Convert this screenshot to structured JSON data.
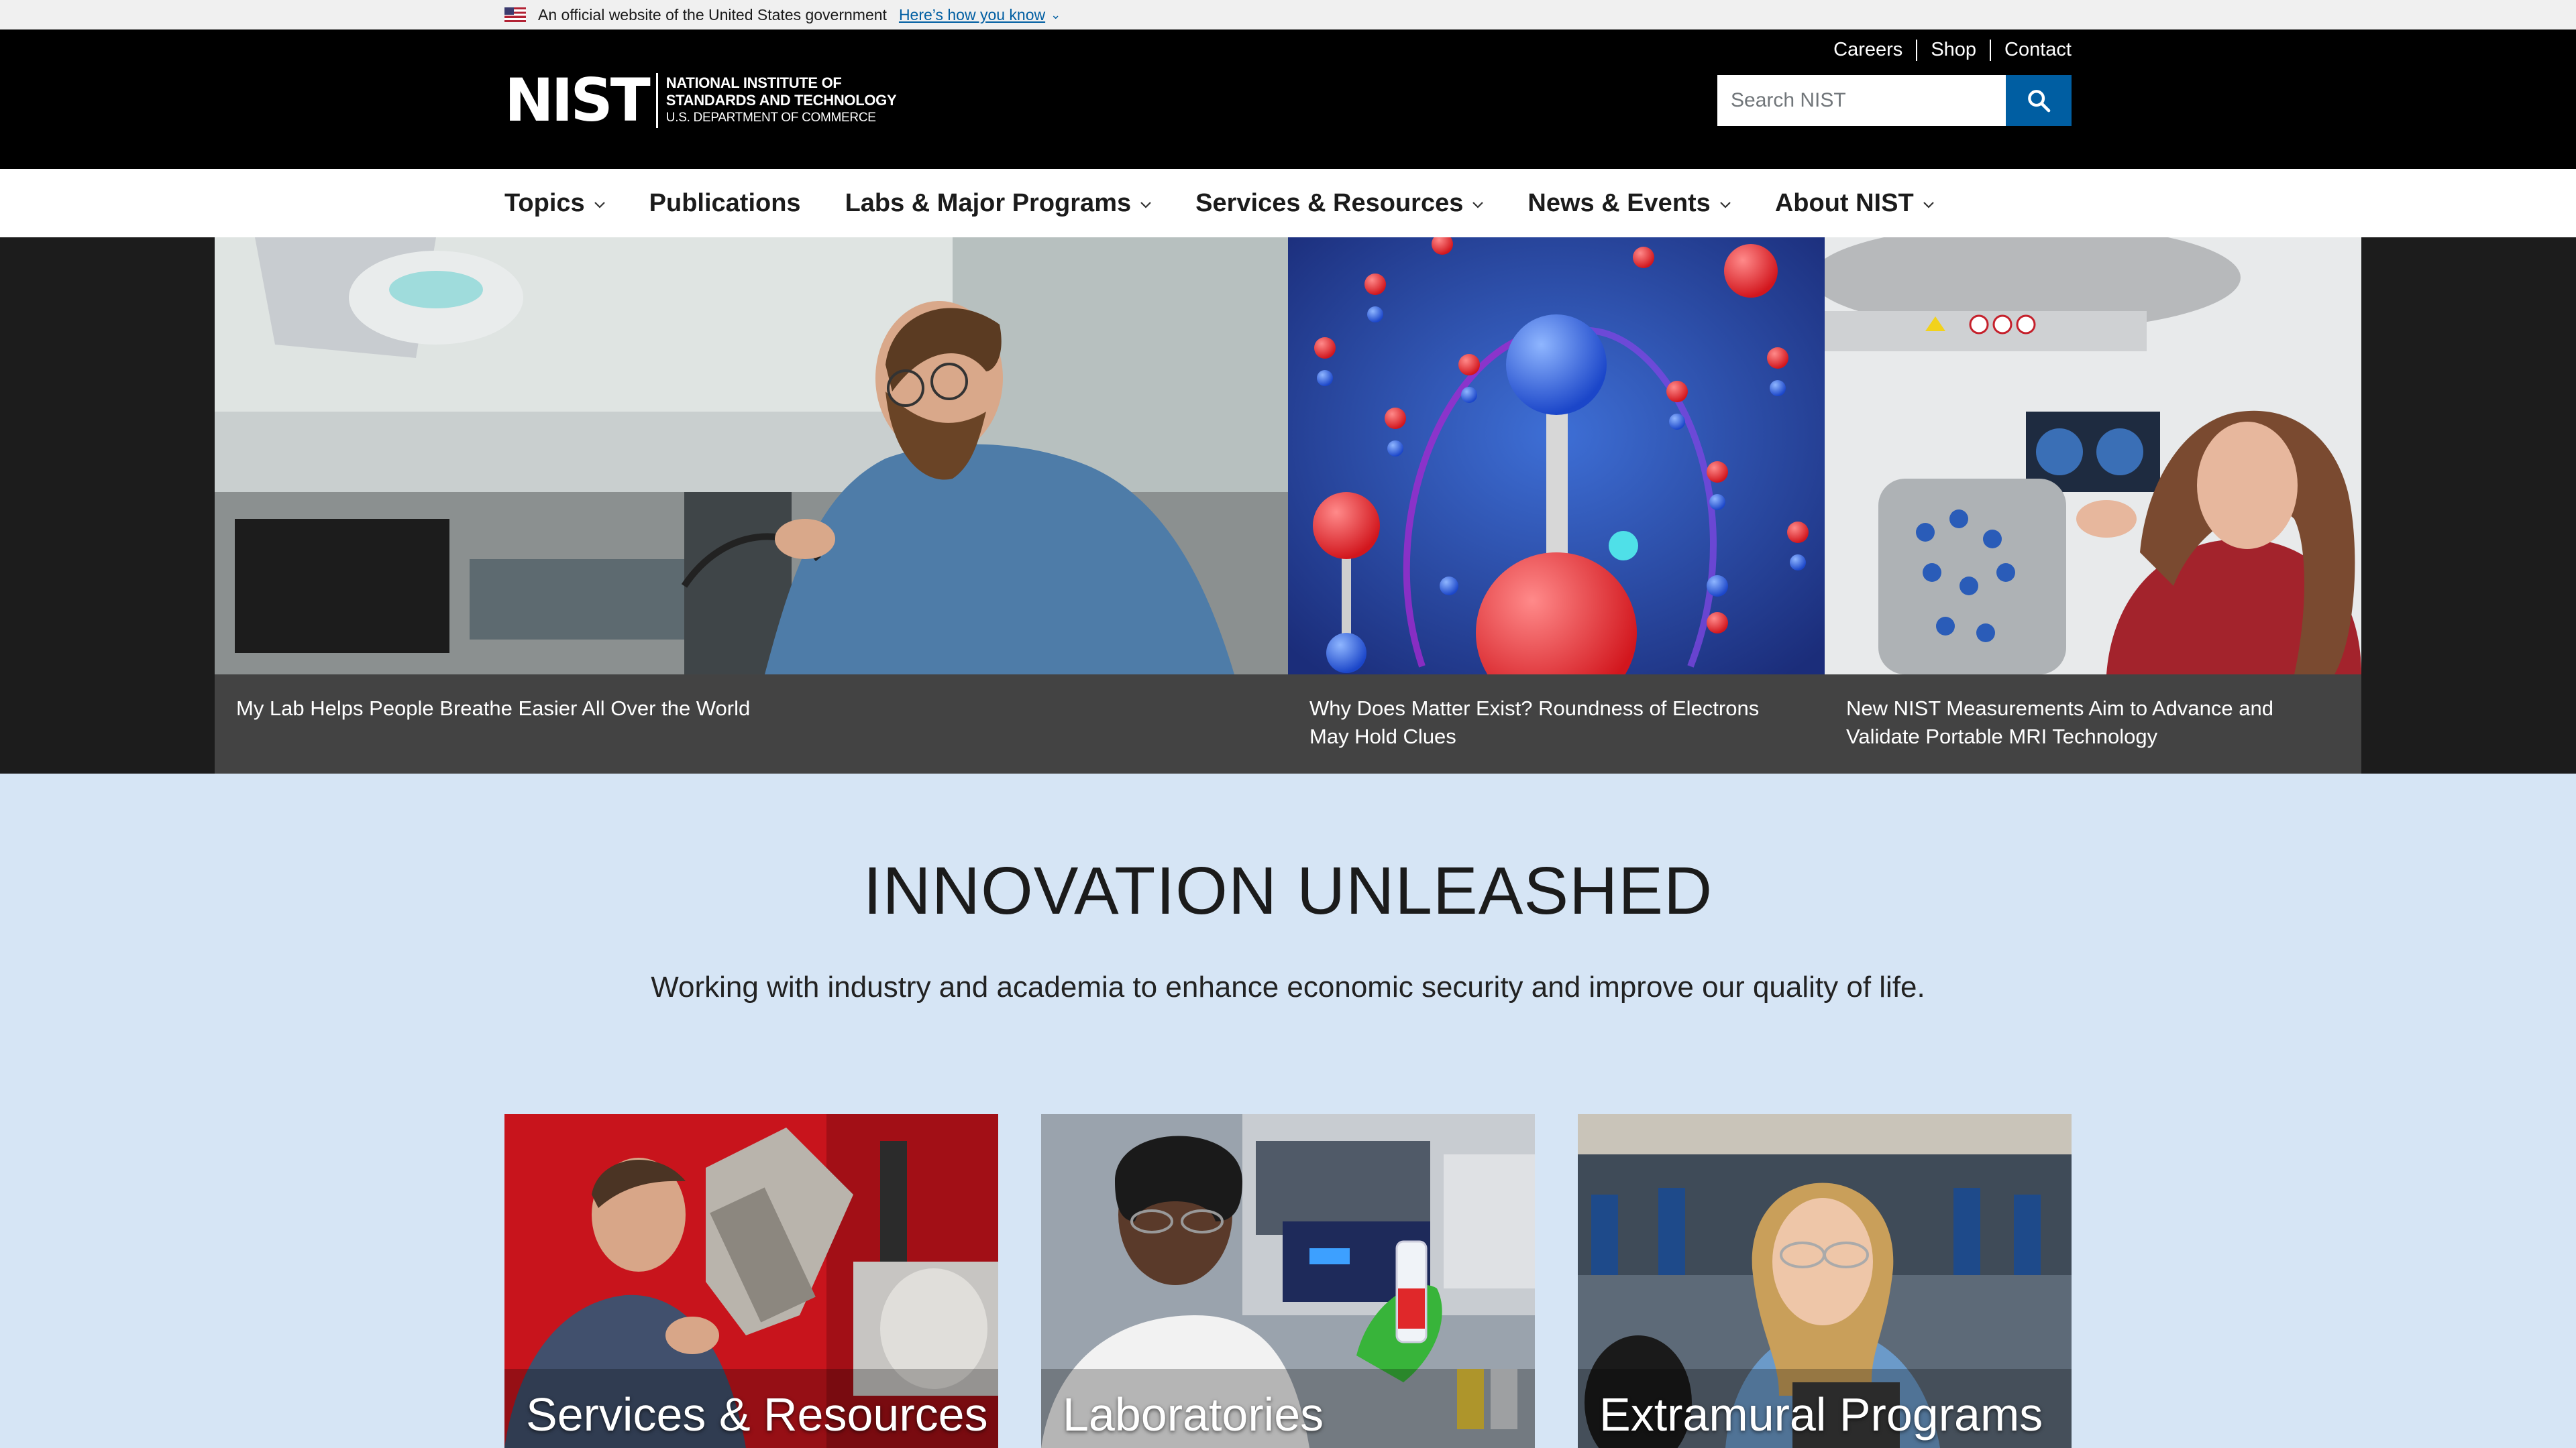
{
  "gov_banner": {
    "text": "An official website of the United States government",
    "link": "Here’s how you know"
  },
  "header": {
    "logo_mark": "NIST",
    "logo_line1": "NATIONAL INSTITUTE OF",
    "logo_line2": "STANDARDS AND TECHNOLOGY",
    "logo_line3": "U.S. DEPARTMENT OF COMMERCE",
    "utility_links": [
      "Careers",
      "Shop",
      "Contact"
    ],
    "search_placeholder": "Search NIST"
  },
  "nav": [
    {
      "label": "Topics",
      "has_menu": true
    },
    {
      "label": "Publications",
      "has_menu": false
    },
    {
      "label": "Labs & Major Programs",
      "has_menu": true
    },
    {
      "label": "Services & Resources",
      "has_menu": true
    },
    {
      "label": "News & Events",
      "has_menu": true
    },
    {
      "label": "About NIST",
      "has_menu": true
    }
  ],
  "hero": [
    {
      "caption": "My Lab Helps People Breathe Easier All Over the World"
    },
    {
      "caption": "Why Does Matter Exist? Roundness of Electrons May Hold Clues"
    },
    {
      "caption": "New NIST Measurements Aim to Advance and Validate Portable MRI Technology"
    }
  ],
  "innovation": {
    "title": "INNOVATION UNLEASHED",
    "subtitle": "Working with industry and academia to enhance economic security and improve our quality of life."
  },
  "cards": [
    {
      "label": "Services & Resources"
    },
    {
      "label": "Laboratories"
    },
    {
      "label": "Extramural Programs"
    }
  ],
  "colors": {
    "header_bg": "#000000",
    "accent_blue": "#005ea2",
    "page_bg": "#d6e5f5",
    "caption_bg": "#464646"
  }
}
